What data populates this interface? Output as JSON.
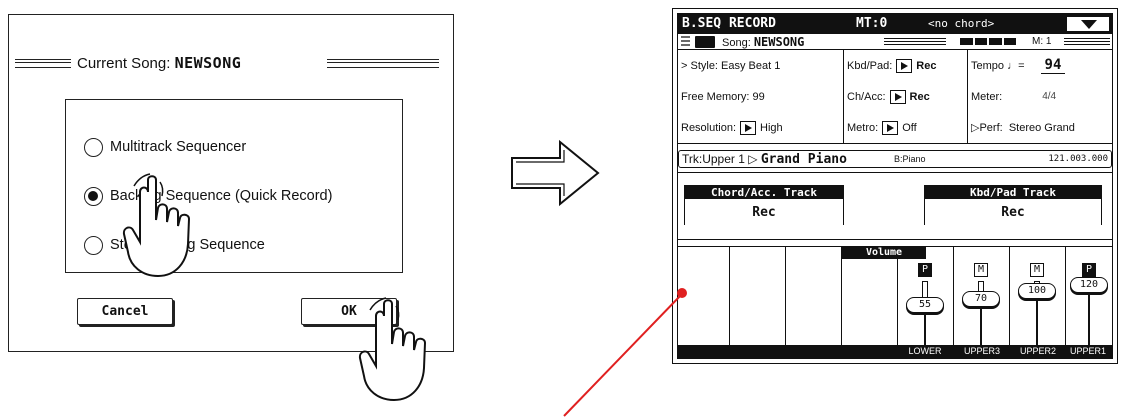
{
  "dialog": {
    "title_prefix": "Current Song:",
    "song_name": "NEWSONG",
    "options": [
      {
        "label": "Multitrack Sequencer",
        "selected": false
      },
      {
        "label": "Backing Sequence (Quick Record)",
        "selected": true
      },
      {
        "label": "Step Backing Sequence",
        "selected": false
      }
    ],
    "cancel_label": "Cancel",
    "ok_label": "OK"
  },
  "display": {
    "header": {
      "mode": "B.SEQ RECORD",
      "mt": "MT:0",
      "chord": "<no chord>"
    },
    "song_row": {
      "label": "Song:",
      "song_name": "NEWSONG",
      "measure": "M: 1"
    },
    "col1": {
      "style": "> Style: Easy Beat 1",
      "free_memory": "Free Memory: 99",
      "resolution_label": "Resolution:",
      "resolution_value": "High"
    },
    "col2": {
      "kbd_label": "Kbd/Pad:",
      "kbd_value": "Rec",
      "chacc_label": "Ch/Acc:",
      "chacc_value": "Rec",
      "metro_label": "Metro:",
      "metro_value": "Off"
    },
    "col3": {
      "tempo_label": "Tempo",
      "tempo_note": "♩=",
      "tempo_value": "94",
      "meter_label": "Meter:",
      "meter_value": "4/4",
      "perf_label": "▷Perf:",
      "perf_value": "Stereo Grand"
    },
    "track_bar": {
      "track": "Trk:Upper 1",
      "sound_prefix": "▷",
      "sound": "Grand Piano",
      "bank": "B:Piano",
      "program": "121.003.000"
    },
    "rec_panel": {
      "chord_title": "Chord/Acc. Track",
      "chord_value": "Rec",
      "kbd_title": "Kbd/Pad Track",
      "kbd_value": "Rec"
    },
    "mixer": {
      "volume_title": "Volume",
      "channels": [
        {
          "name": "LOWER",
          "status": "P",
          "volume": 55
        },
        {
          "name": "UPPER3",
          "status": "M",
          "volume": 70
        },
        {
          "name": "UPPER2",
          "status": "M",
          "volume": 100
        },
        {
          "name": "UPPER1",
          "status": "P",
          "volume": 120
        }
      ]
    }
  }
}
